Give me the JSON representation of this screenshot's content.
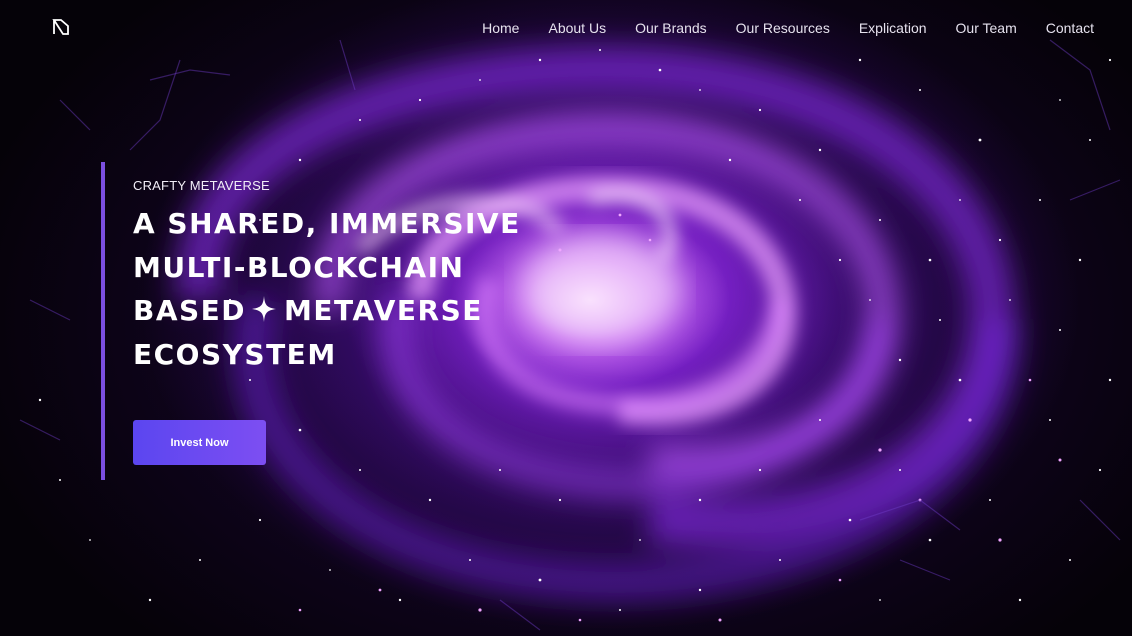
{
  "header": {
    "logo_icon": "logo-mark-icon",
    "nav": [
      {
        "label": "Home"
      },
      {
        "label": "About Us"
      },
      {
        "label": "Our Brands"
      },
      {
        "label": "Our Resources"
      },
      {
        "label": "Explication"
      },
      {
        "label": "Our Team"
      },
      {
        "label": "Contact"
      }
    ]
  },
  "hero": {
    "eyebrow": "CRAFTY METAVERSE",
    "headline": {
      "line1": "A SHARED, IMMERSIVE",
      "line2": "MULTI-BLOCKCHAIN",
      "line3_before": "BASED",
      "line3_after": "METAVERSE",
      "line4": "ECOSYSTEM"
    },
    "sparkle_icon": "sparkle-icon",
    "cta_label": "Invest Now"
  },
  "colors": {
    "accent_bar": "#7b4fe0",
    "cta_gradient_start": "#5b46f0",
    "cta_gradient_end": "#7d4ef2",
    "galaxy_core": "#e9b7ff",
    "galaxy_arm": "#9b3cf2",
    "background": "#050208"
  }
}
